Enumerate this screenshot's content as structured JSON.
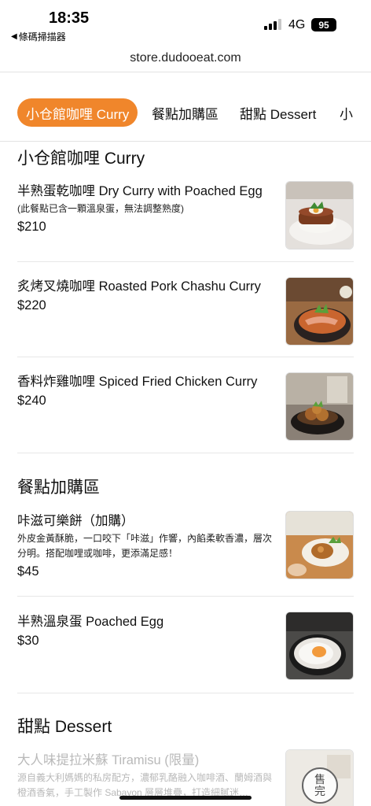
{
  "status_bar": {
    "time": "18:35",
    "back_app": "條碼掃描器",
    "network": "4G",
    "battery": "95"
  },
  "browser": {
    "url": "store.dudooeat.com"
  },
  "tabs": [
    {
      "label": "小仓館咖哩 Curry",
      "active": true
    },
    {
      "label": "餐點加購區",
      "active": false
    },
    {
      "label": "甜點 Dessert",
      "active": false
    },
    {
      "label": "小",
      "active": false
    }
  ],
  "sections": [
    {
      "title": "小仓館咖哩 Curry",
      "items": [
        {
          "name": "半熟蛋乾咖哩 Dry Curry with Poached Egg",
          "desc": "(此餐點已含一顆溫泉蛋，無法調整熟度)",
          "price": "$210",
          "image": "dry-curry-photo"
        },
        {
          "name": "炙烤叉燒咖哩 Roasted Pork Chashu Curry",
          "price": "$220",
          "image": "chashu-curry-photo"
        },
        {
          "name": "香料炸雞咖哩 Spiced Fried Chicken Curry",
          "price": "$240",
          "image": "fried-chicken-curry-photo"
        }
      ]
    },
    {
      "title": "餐點加購區",
      "items": [
        {
          "name": "咔滋可樂餅（加購）",
          "desc": "外皮金黃酥脆，一口咬下「咔滋」作響，內餡柔軟香濃，層次分明。搭配咖哩或咖啡，更添滿足感！",
          "price": "$45",
          "image": "croquette-photo"
        },
        {
          "name": "半熟溫泉蛋 Poached Egg",
          "price": "$30",
          "image": "poached-egg-photo"
        }
      ]
    },
    {
      "title": "甜點 Dessert",
      "items": [
        {
          "name": "大人味提拉米蘇 Tiramisu (限量)",
          "desc": "源自義大利媽媽的私房配方，濃郁乳酪融入咖啡酒、蘭姆酒與橙酒香氣，手工製作 Sabayon 層層堆疊，打造細膩迷…",
          "sold_out_stamp": "售完",
          "image": "tiramisu-photo"
        }
      ]
    }
  ]
}
